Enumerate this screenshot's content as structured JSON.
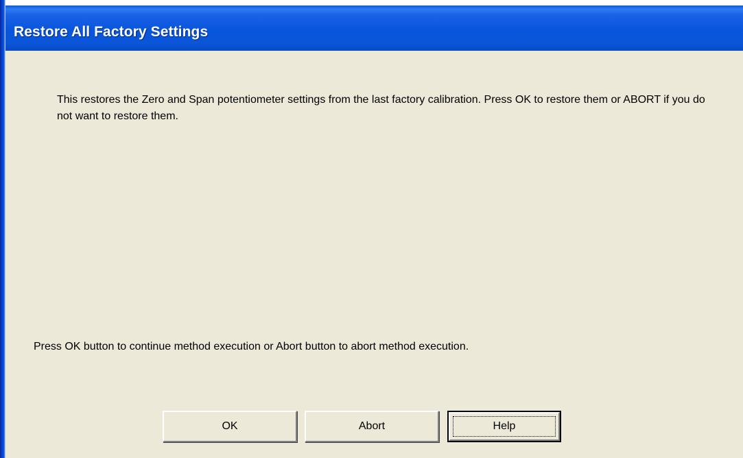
{
  "window": {
    "title": "Restore All Factory Settings"
  },
  "body": {
    "message": "This restores the Zero and Span potentiometer settings from the last factory calibration.  Press OK to restore them or ABORT if you do not want to restore them.",
    "instruction": "Press OK button to continue method execution or Abort button to abort method execution."
  },
  "buttons": {
    "ok_label": "OK",
    "abort_label": "Abort",
    "help_label": "Help"
  },
  "colors": {
    "titlebar": "#0856dc",
    "dialog_background": "#ece9d8",
    "title_text": "#ffffff"
  }
}
